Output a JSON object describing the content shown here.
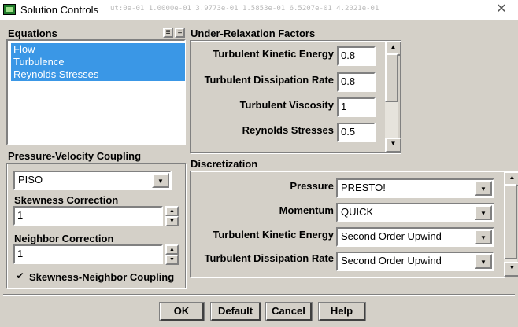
{
  "window": {
    "title": "Solution Controls",
    "title_noise": "ut:0e-01 1.0000e-01 3.9773e-01 1.5853e-01 6.5207e-01 4.2021e-01",
    "close_glyph": "✕"
  },
  "equations": {
    "heading": "Equations",
    "items": [
      "Flow",
      "Turbulence",
      "Reynolds Stresses"
    ],
    "btn_a": "≡",
    "btn_b": "="
  },
  "relaxation": {
    "heading": "Under-Relaxation Factors",
    "fields": [
      {
        "label": "Turbulent Kinetic Energy",
        "value": "0.8"
      },
      {
        "label": "Turbulent Dissipation Rate",
        "value": "0.8"
      },
      {
        "label": "Turbulent Viscosity",
        "value": "1"
      },
      {
        "label": "Reynolds Stresses",
        "value": "0.5"
      }
    ]
  },
  "pv_coupling": {
    "heading": "Pressure-Velocity Coupling",
    "scheme": "PISO",
    "skewness_label": "Skewness Correction",
    "skewness_value": "1",
    "neighbor_label": "Neighbor Correction",
    "neighbor_value": "1",
    "coupling_label": "Skewness-Neighbor Coupling",
    "coupling_checked": true,
    "check_glyph": "✔"
  },
  "discretization": {
    "heading": "Discretization",
    "rows": [
      {
        "label": "Pressure",
        "value": "PRESTO!"
      },
      {
        "label": "Momentum",
        "value": "QUICK"
      },
      {
        "label": "Turbulent Kinetic Energy",
        "value": "Second Order Upwind"
      },
      {
        "label": "Turbulent Dissipation Rate",
        "value": "Second Order Upwind"
      }
    ]
  },
  "buttons": {
    "ok": "OK",
    "default": "Default",
    "cancel": "Cancel",
    "help": "Help"
  },
  "glyphs": {
    "up": "▲",
    "down": "▼"
  }
}
